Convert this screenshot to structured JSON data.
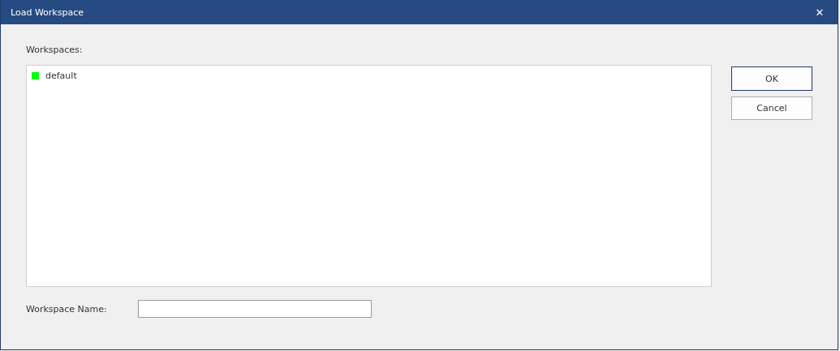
{
  "window": {
    "title": "Load Workspace",
    "close": "✕"
  },
  "workspaces": {
    "label": "Workspaces:",
    "items": [
      {
        "name": "default",
        "color": "#00ff00",
        "selected": false
      }
    ]
  },
  "buttons": [
    {
      "label": "OK",
      "default": true
    },
    {
      "label": "Cancel",
      "default": false
    }
  ],
  "workspace_name": {
    "label": "Workspace Name:"
  }
}
